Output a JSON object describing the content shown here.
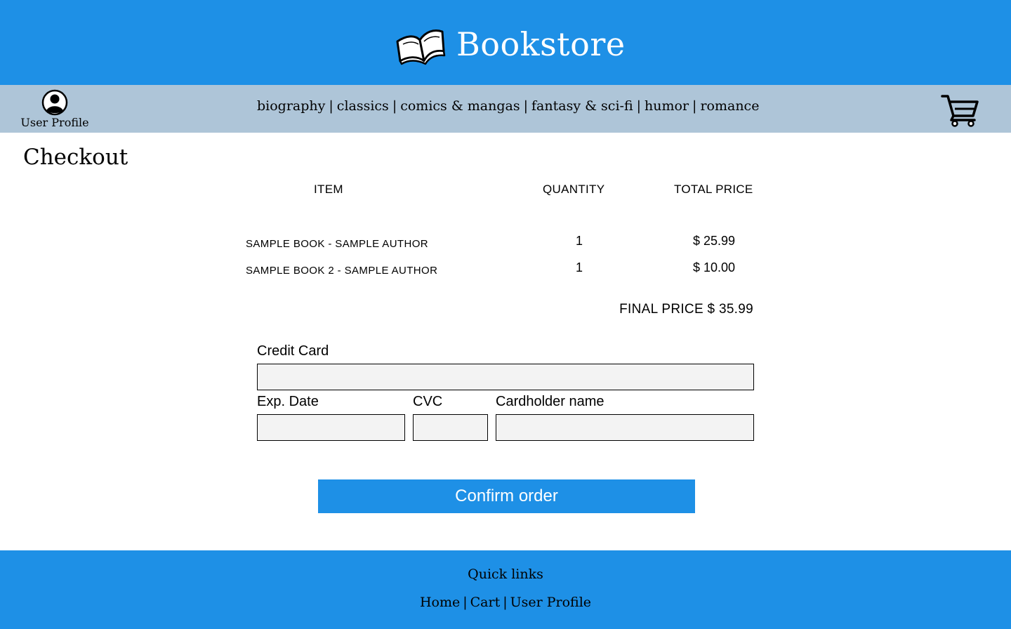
{
  "header": {
    "title": "Bookstore",
    "brand_icon": "open-book-icon",
    "color": "#1e90e6"
  },
  "nav": {
    "profile_label": "User Profile",
    "profile_icon": "user-circle-icon",
    "cart_icon": "shopping-cart-icon",
    "categories": [
      "biography",
      "classics",
      "comics & mangas",
      "fantasy & sci-fi",
      "humor",
      "romance"
    ],
    "separator": "|",
    "color": "#aec5d8"
  },
  "main": {
    "title": "Checkout",
    "columns": {
      "item": "ITEM",
      "quantity": "QUANTITY",
      "total_price": "TOTAL PRICE"
    },
    "items": [
      {
        "name": "SAMPLE BOOK - SAMPLE AUTHOR",
        "quantity": "1",
        "price": "$ 25.99"
      },
      {
        "name": "SAMPLE BOOK 2 - SAMPLE AUTHOR",
        "quantity": "1",
        "price": "$ 10.00"
      }
    ],
    "final_price": "FINAL PRICE $ 35.99"
  },
  "form": {
    "credit_card_label": "Credit Card",
    "credit_card_value": "",
    "exp_date_label": "Exp. Date",
    "exp_date_value": "",
    "cvc_label": "CVC",
    "cvc_value": "",
    "cardholder_label": "Cardholder name",
    "cardholder_value": "",
    "confirm_label": "Confirm order"
  },
  "footer": {
    "title": "Quick links",
    "links": [
      "Home",
      "Cart",
      "User Profile"
    ],
    "separator": "|"
  }
}
